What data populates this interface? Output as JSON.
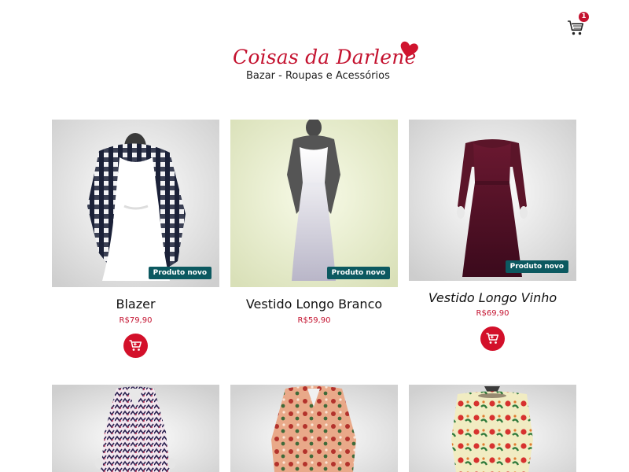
{
  "header": {
    "brand_name": "Coisas da Darlene",
    "brand_tagline": "Bazar - Roupas e Acessórios",
    "cart_count": "1",
    "cart_icon": "shopping-cart-icon",
    "logo_icon": "heart-icon"
  },
  "colors": {
    "brand_red": "#c4122f",
    "badge_teal": "#0c5960",
    "button_red": "#d3102a"
  },
  "products": [
    {
      "title": "Blazer",
      "price": "R$79,90",
      "badge": "Produto novo"
    },
    {
      "title": "Vestido Longo Branco",
      "price": "R$59,90",
      "badge": "Produto novo"
    },
    {
      "title": "Vestido Longo Vinho",
      "price": "R$69,90",
      "badge": "Produto novo"
    },
    {
      "title": "",
      "price": "",
      "badge": ""
    },
    {
      "title": "",
      "price": "",
      "badge": ""
    },
    {
      "title": "",
      "price": "",
      "badge": ""
    }
  ]
}
